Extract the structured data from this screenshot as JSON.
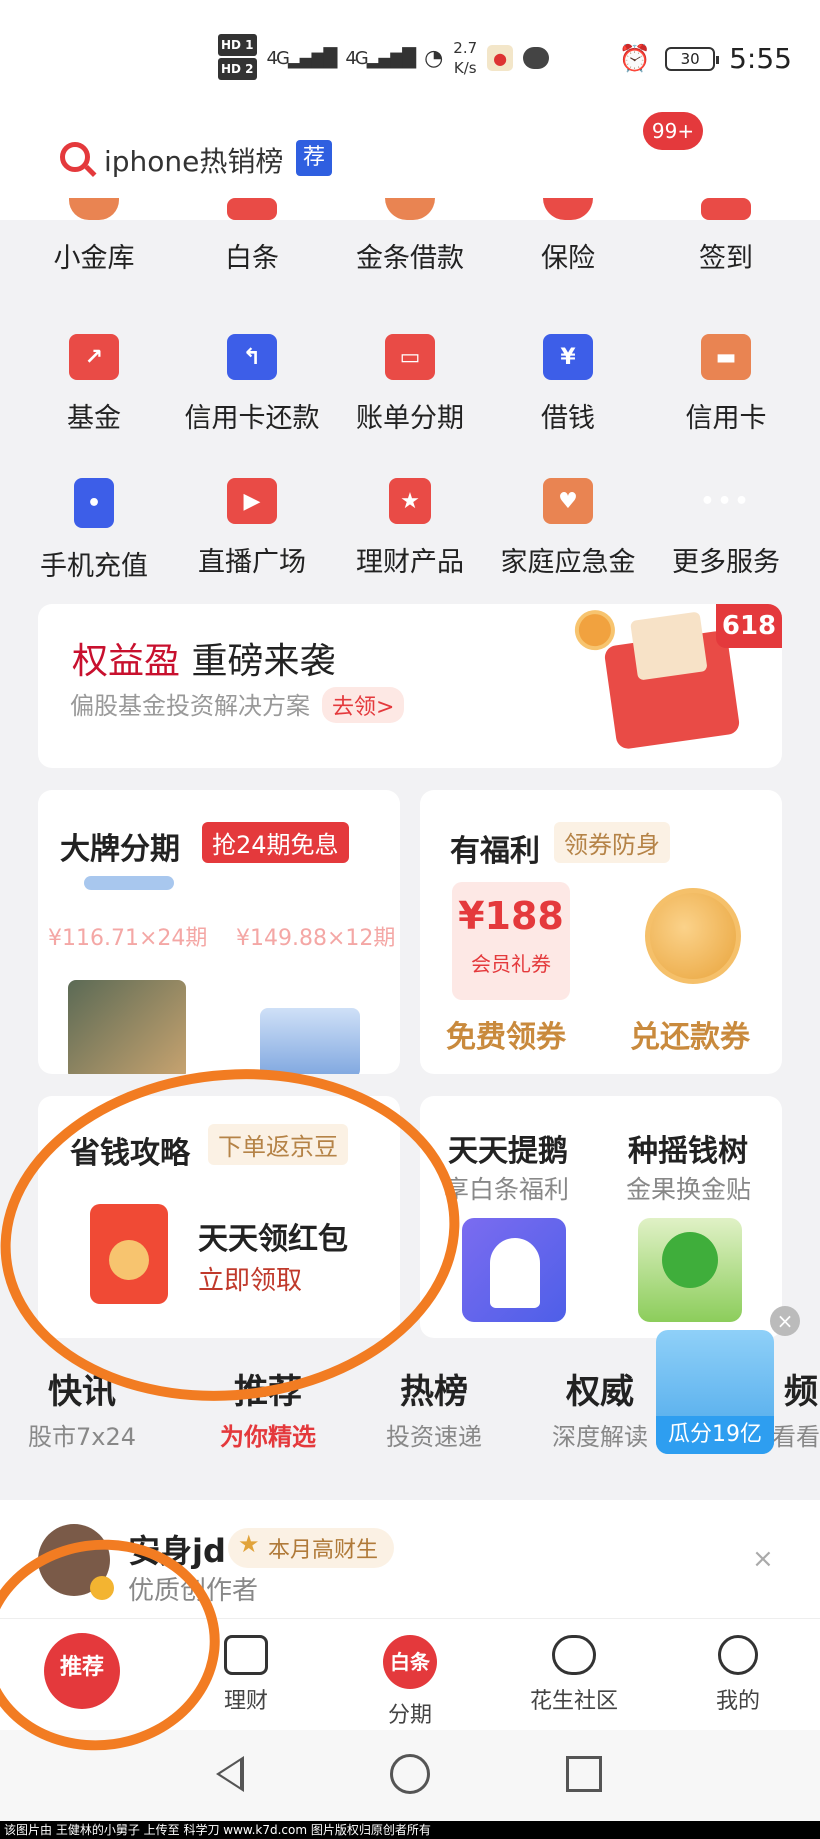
{
  "status": {
    "hd1": "HD 1",
    "hd2": "HD 2",
    "sig1": "4G",
    "sig2": "4G",
    "speed_value": "2.7",
    "speed_unit": "K/s",
    "battery": "30",
    "time": "5:55"
  },
  "search": {
    "text": "iphone热销榜",
    "tag": "荐",
    "badge": "99+"
  },
  "services": [
    [
      {
        "label": "小金库",
        "icon": "coin-icon",
        "color": "orange"
      },
      {
        "label": "白条",
        "icon": "card-icon",
        "color": "red"
      },
      {
        "label": "金条借款",
        "icon": "plus-icon",
        "color": "orange"
      },
      {
        "label": "保险",
        "icon": "heart-icon",
        "color": "red"
      },
      {
        "label": "签到",
        "icon": "calendar-icon",
        "color": "red"
      }
    ],
    [
      {
        "label": "基金",
        "icon": "chart-icon",
        "color": "red"
      },
      {
        "label": "信用卡还款",
        "icon": "repay-icon",
        "color": "blue"
      },
      {
        "label": "账单分期",
        "icon": "bill-icon",
        "color": "red"
      },
      {
        "label": "借钱",
        "icon": "yen-icon",
        "color": "blue"
      },
      {
        "label": "信用卡",
        "icon": "wallet-icon",
        "color": "orange"
      }
    ],
    [
      {
        "label": "手机充值",
        "icon": "phone-icon",
        "color": "blue"
      },
      {
        "label": "直播广场",
        "icon": "tv-icon",
        "color": "red"
      },
      {
        "label": "理财产品",
        "icon": "bookmark-star-icon",
        "color": "red"
      },
      {
        "label": "家庭应急金",
        "icon": "house-heart-icon",
        "color": "orange"
      },
      {
        "label": "更多服务",
        "icon": "more-dots-icon",
        "color": "gray"
      }
    ]
  ],
  "promo": {
    "title_hl": "权益盈",
    "title_rest": " 重磅来袭",
    "subtitle": "偏股基金投资解决方案",
    "go": "去领>",
    "tag": "618"
  },
  "brand": {
    "title": "大牌分期",
    "tag": "抢24期免息",
    "price1": "¥116.71×24期",
    "price2": "¥149.88×12期"
  },
  "benefit": {
    "title": "有福利",
    "tag": "领券防身",
    "coupon_amount": "¥188",
    "coupon_label": "会员礼券",
    "free_label": "免费领券",
    "cash_label": "兑还款券"
  },
  "save": {
    "title": "省钱攻略",
    "tag": "下单返京豆",
    "packet_title": "天天领红包",
    "packet_action": "立即领取"
  },
  "tiepeng": {
    "title": "天天提鹅",
    "sub": "享白条福利"
  },
  "tree": {
    "title": "种摇钱树",
    "sub": "金果换金贴"
  },
  "tabs": [
    {
      "title": "快讯",
      "sub": "股市7x24"
    },
    {
      "title": "推荐",
      "sub": "为你精选"
    },
    {
      "title": "热榜",
      "sub": "投资速递"
    },
    {
      "title": "权威",
      "sub": "深度解读"
    },
    {
      "title": "频",
      "sub": "看看"
    }
  ],
  "floater": {
    "label": "瓜分19亿",
    "close": "×"
  },
  "author": {
    "name": "安身jd",
    "badge": "本月高财生",
    "sub": "优质创作者",
    "close": "×"
  },
  "bottom_nav": [
    {
      "label": "推荐"
    },
    {
      "label": "理财"
    },
    {
      "label": "分期",
      "icon_text": "白条"
    },
    {
      "label": "花生社区"
    },
    {
      "label": "我的"
    }
  ],
  "footer": "该图片由 王健林的小舅子 上传至 科学刀 www.k7d.com 图片版权归原创者所有"
}
